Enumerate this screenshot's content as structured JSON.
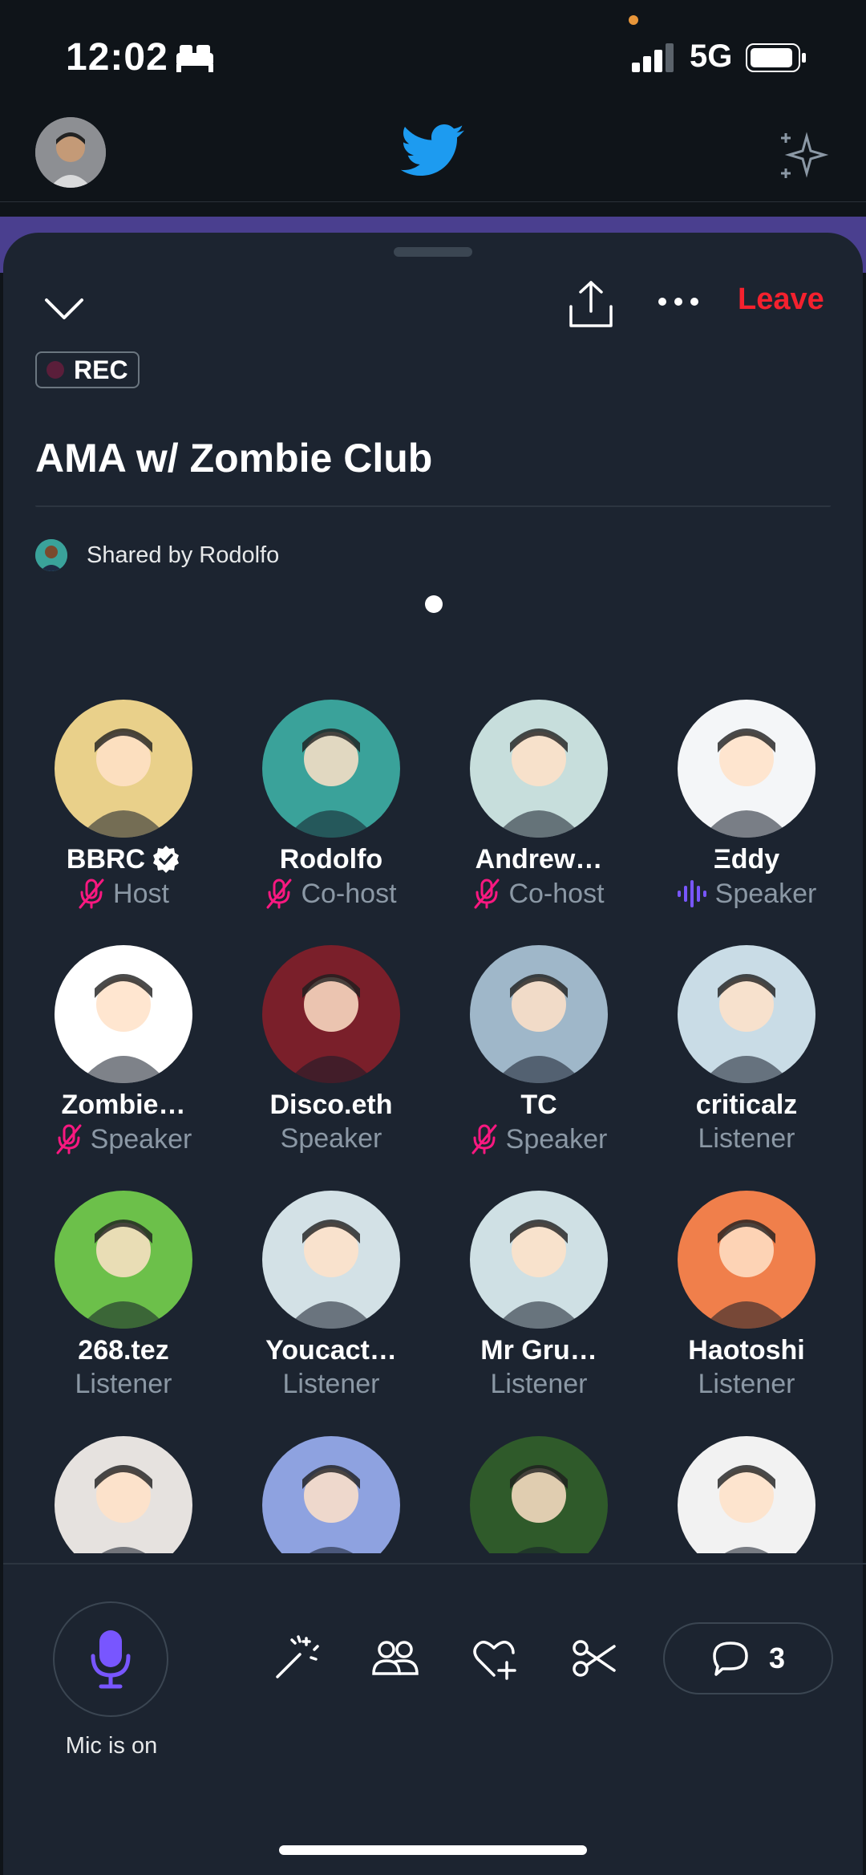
{
  "status_bar": {
    "time": "12:02",
    "network": "5G"
  },
  "header": {
    "leave_label": "Leave",
    "rec_label": "REC"
  },
  "space": {
    "title": "AMA w/ Zombie Club",
    "shared_by": "Shared by Rodolfo"
  },
  "participants": [
    {
      "name": "BBRC",
      "role": "Host",
      "verified": true,
      "mic": "muted",
      "avatar_color": "#e9d08a"
    },
    {
      "name": "Rodolfo",
      "role": "Co-host",
      "mic": "muted",
      "avatar_color": "#3aa29a"
    },
    {
      "name": "Andrew…",
      "role": "Co-host",
      "mic": "muted",
      "avatar_color": "#c7dedc"
    },
    {
      "name": "Ξddy",
      "role": "Speaker",
      "mic": "speaking",
      "avatar_color": "#f4f6f8"
    },
    {
      "name": "Zombie…",
      "role": "Speaker",
      "mic": "muted",
      "avatar_color": "#ffffff"
    },
    {
      "name": "Disco.eth",
      "role": "Speaker",
      "mic": "none",
      "avatar_color": "#7a1f2a"
    },
    {
      "name": "TC",
      "role": "Speaker",
      "mic": "muted",
      "avatar_color": "#9fb7c9"
    },
    {
      "name": "criticalz",
      "role": "Listener",
      "mic": "none",
      "avatar_color": "#c9dce6"
    },
    {
      "name": "268.tez",
      "role": "Listener",
      "mic": "none",
      "avatar_color": "#6cc04a"
    },
    {
      "name": "Youcact…",
      "role": "Listener",
      "mic": "none",
      "avatar_color": "#d3e1e6"
    },
    {
      "name": "Mr Gru…",
      "role": "Listener",
      "mic": "none",
      "avatar_color": "#cfe0e4"
    },
    {
      "name": "Haotoshi",
      "role": "Listener",
      "mic": "none",
      "avatar_color": "#f07f4b"
    },
    {
      "name": "",
      "role": "",
      "mic": "none",
      "avatar_color": "#e6e2df"
    },
    {
      "name": "",
      "role": "",
      "mic": "none",
      "avatar_color": "#8ea2e0"
    },
    {
      "name": "",
      "role": "",
      "mic": "none",
      "avatar_color": "#2f5a2a"
    },
    {
      "name": "",
      "role": "",
      "mic": "none",
      "avatar_color": "#f2f2f2"
    }
  ],
  "footer": {
    "mic_label": "Mic is on",
    "comments_count": "3"
  },
  "colors": {
    "accent_purple": "#7856ff",
    "muted_pink": "#f91880",
    "leave_red": "#f4212e",
    "sheet_bg": "#1c2430"
  }
}
